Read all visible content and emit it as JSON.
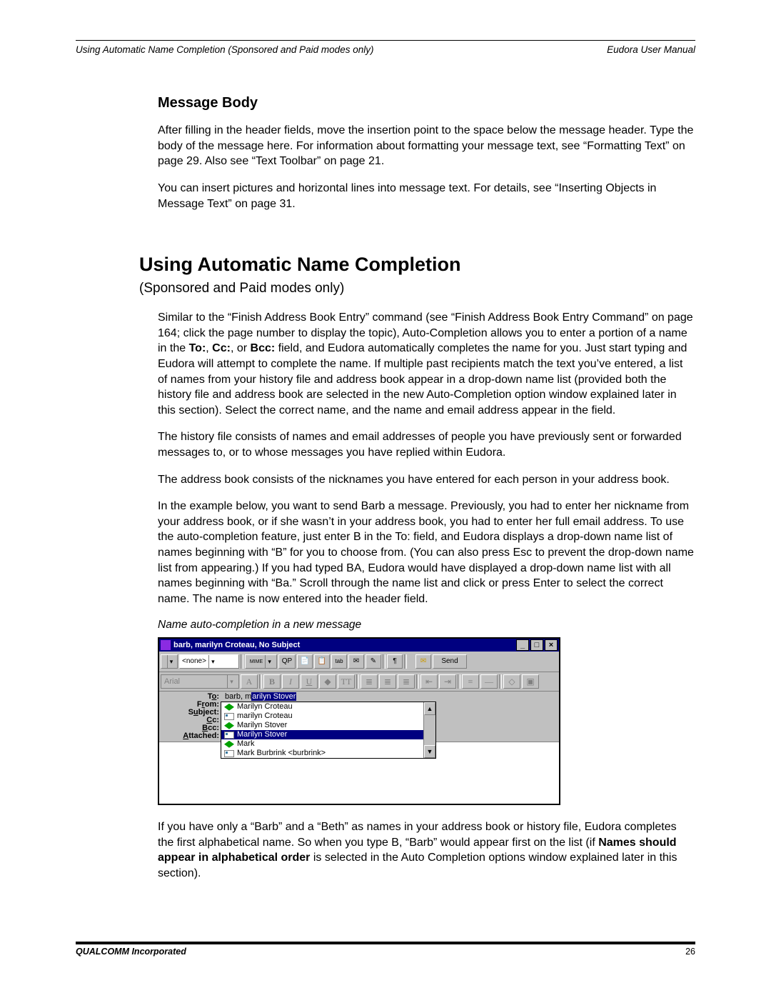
{
  "header": {
    "running_left": "Using Automatic Name Completion (Sponsored and Paid modes only)",
    "running_right": "Eudora User Manual"
  },
  "sections": {
    "msgbody": {
      "title": "Message Body",
      "p1": "After filling in the header fields, move the insertion point to the space below the message header. Type the body of the message here. For information about formatting your message text, see “Formatting Text” on page 29. Also see “Text Toolbar” on page 21.",
      "p2": "You can insert pictures and horizontal lines into message text. For details, see “Inserting Objects in Message Text” on page 31."
    },
    "autoname": {
      "title": "Using Automatic Name Completion",
      "subtitle": "(Sponsored and Paid modes only)",
      "p1_a": "Similar to the “Finish Address Book Entry” command (see “Finish Address Book Entry Command” on page 164; click the page number to display the topic), Auto-Completion allows you to enter a portion of a name in the ",
      "to_label": "To:",
      "comma1": ", ",
      "cc_label": "Cc:",
      "comma2": ", or ",
      "bcc_label": "Bcc:",
      "p1_b": " field, and Eudora automatically completes the name for you. Just start typing and Eudora will attempt to complete the name. If multiple past recipients match the text you’ve entered, a list of names from your history file and address book appear in a drop-down name list (provided both the history file and address book are selected in the new Auto-Completion option window explained later in this section). Select the correct name, and the name and email address appear in the field.",
      "p2": "The history file consists of names and email addresses of people you have previously sent or forwarded messages to, or to whose messages you have replied within Eudora.",
      "p3": "The address book consists of the nicknames you have entered for each person in your address book.",
      "p4": "In the example below, you want to send Barb a message. Previously, you had to enter her nickname from your address book, or if she wasn’t in your address book, you had to enter her full email address. To use the auto-completion feature, just enter B in the To: field, and Eudora displays a drop-down name list of names beginning with “B” for you to choose from. (You can also press Esc to prevent the drop-down name list from appearing.) If you had typed BA, Eudora would have displayed a drop-down name list with all names beginning with “Ba.” Scroll through the name list and click or press Enter to select the correct name. The name is now entered into the header field.",
      "caption": "Name auto-completion in a new message",
      "p5_a": "If you have only a “Barb” and a “Beth” as names in your address book or history file, Eudora completes the first alphabetical name. So when you type B, “Barb” would appear first on the list (if ",
      "p5_bold": "Names should appear in alphabetical order",
      "p5_b": " is selected in the Auto Completion options window explained later in this section)."
    }
  },
  "win": {
    "title": "barb, marilyn Croteau, No Subject",
    "min": "_",
    "max": "□",
    "close": "×",
    "tb": {
      "prio": "",
      "sig": "<none>",
      "mime": "MIME",
      "qp": "QP",
      "a1": "📄",
      "a2": "📋",
      "a3": "tab",
      "a4": "✉",
      "a5": "✎",
      "a6": "¶",
      "send": "Send",
      "sendico": "✉"
    },
    "fmt": {
      "font": "Arial",
      "bold": "B",
      "italic": "I",
      "under": "U"
    },
    "hdr": {
      "to": "To:",
      "from": "From:",
      "subject": "Subject:",
      "cc": "Cc:",
      "bcc": "Bcc:",
      "attached": "Attached:",
      "to_typed": "barb, m",
      "to_completion": "arilyn Stover"
    },
    "dd": {
      "items": [
        {
          "icon": "book",
          "text": "Marilyn Croteau",
          "sel": false
        },
        {
          "icon": "card",
          "text": "marilyn Croteau",
          "sel": false
        },
        {
          "icon": "book",
          "text": "Marilyn Stover",
          "sel": false
        },
        {
          "icon": "card",
          "text": "Marilyn Stover",
          "sel": true
        },
        {
          "icon": "book",
          "text": "Mark",
          "sel": false
        },
        {
          "icon": "card",
          "text": "Mark Burbrink  <burbrink>",
          "sel": false
        }
      ]
    }
  },
  "footer": {
    "corp": "QUALCOMM Incorporated",
    "pageno": "26"
  }
}
